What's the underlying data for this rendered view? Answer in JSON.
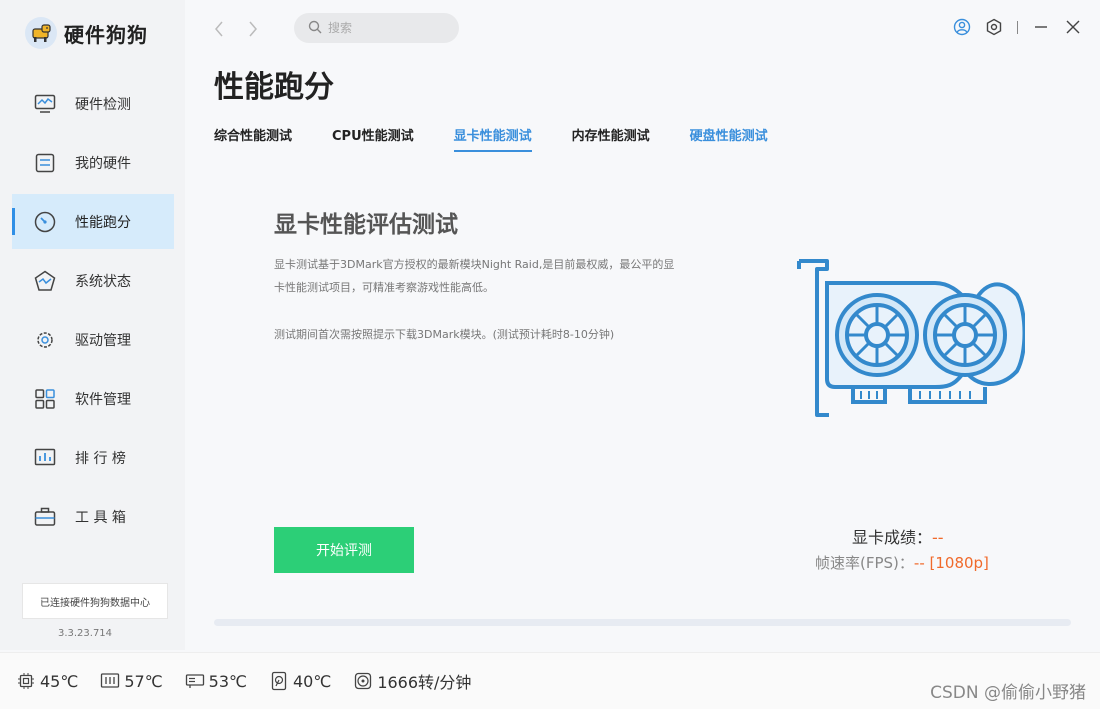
{
  "app": {
    "name": "硬件狗狗",
    "version": "3.3.23.714"
  },
  "sidebar": {
    "items": [
      {
        "label": "硬件检测",
        "icon": "monitor-icon",
        "active": false
      },
      {
        "label": "我的硬件",
        "icon": "hardware-icon",
        "active": false
      },
      {
        "label": "性能跑分",
        "icon": "gauge-icon",
        "active": true
      },
      {
        "label": "系统状态",
        "icon": "system-status-icon",
        "active": false
      },
      {
        "label": "驱动管理",
        "icon": "gear-icon",
        "active": false
      },
      {
        "label": "软件管理",
        "icon": "apps-grid-icon",
        "active": false
      },
      {
        "label": "排 行 榜",
        "icon": "ranking-icon",
        "active": false
      },
      {
        "label": "工 具 箱",
        "icon": "toolbox-icon",
        "active": false
      }
    ],
    "sync_status": "已连接硬件狗狗数据中心"
  },
  "topbar": {
    "search_placeholder": "搜索"
  },
  "page": {
    "title": "性能跑分",
    "tabs": [
      {
        "label": "综合性能测试",
        "state": "normal"
      },
      {
        "label": "CPU性能测试",
        "state": "normal"
      },
      {
        "label": "显卡性能测试",
        "state": "active"
      },
      {
        "label": "内存性能测试",
        "state": "normal"
      },
      {
        "label": "硬盘性能测试",
        "state": "blue"
      }
    ],
    "section_title": "显卡性能评估测试",
    "description": "显卡测试基于3DMark官方授权的最新模块Night Raid,是目前最权威，最公平的显卡性能测试项目，可精准考察游戏性能高低。",
    "note": "测试期间首次需按照提示下载3DMark模块。(测试预计耗时8-10分钟)",
    "start_button": "开始评测",
    "score_label": "显卡成绩：",
    "score_value": "--",
    "fps_label": "帧速率(FPS)：",
    "fps_value": "-- [1080p]",
    "progress_percent": 0
  },
  "statusbar": {
    "items": [
      {
        "icon": "cpu-icon",
        "value": "45℃"
      },
      {
        "icon": "motherboard-icon",
        "value": "57℃"
      },
      {
        "icon": "gpu-icon",
        "value": "53℃"
      },
      {
        "icon": "disk-icon",
        "value": "40℃"
      },
      {
        "icon": "fan-icon",
        "value": "1666转/分钟"
      }
    ],
    "watermark": "CSDN @偷偷小野猪"
  },
  "colors": {
    "accent": "#3a8fdc",
    "start_button": "#2ccf77",
    "score_value": "#f06a2b",
    "active_nav_bg": "#d6ebfb"
  }
}
